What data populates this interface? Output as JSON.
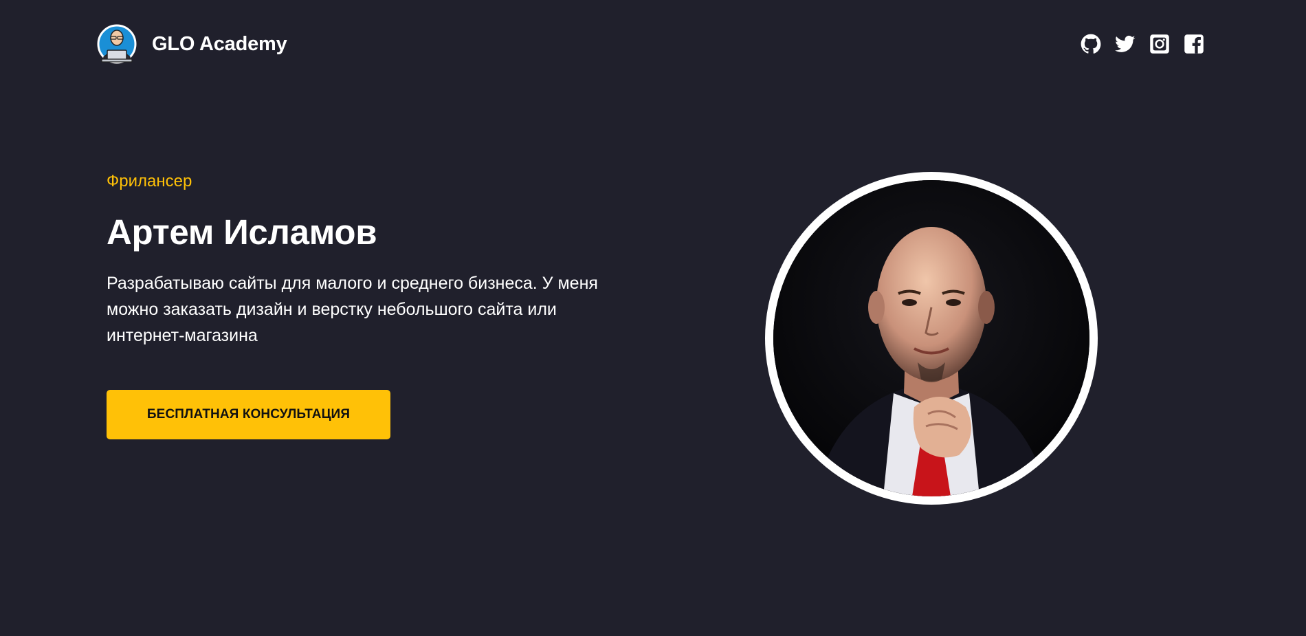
{
  "header": {
    "brand_name": "GLO Academy",
    "logo_icon": "avatar-logo-icon",
    "socials": [
      {
        "name": "github",
        "icon": "github-icon"
      },
      {
        "name": "twitter",
        "icon": "twitter-icon"
      },
      {
        "name": "instagram",
        "icon": "instagram-icon"
      },
      {
        "name": "facebook",
        "icon": "facebook-icon"
      }
    ]
  },
  "hero": {
    "role": "Фрилансер",
    "name": "Артем Исламов",
    "description": "Разрабатываю сайты для малого и среднего бизнеса. У меня можно заказать дизайн и верстку небольшого сайта или интернет-магазина",
    "cta_label": "БЕСПЛАТНАЯ КОНСУЛЬТАЦИЯ"
  },
  "colors": {
    "background": "#20202c",
    "accent": "#ffc107",
    "text": "#ffffff"
  }
}
